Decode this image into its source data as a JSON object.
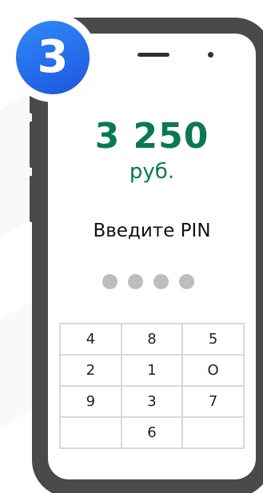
{
  "step_badge": {
    "number": "3"
  },
  "payment": {
    "amount": "3 250",
    "currency": "руб."
  },
  "pin": {
    "label": "Введите PIN",
    "dots_count": 4
  },
  "keypad": {
    "rows": [
      [
        "4",
        "8",
        "5"
      ],
      [
        "2",
        "1",
        "O"
      ],
      [
        "9",
        "3",
        "7"
      ],
      [
        "",
        "6",
        ""
      ]
    ]
  },
  "colors": {
    "accent_green": "#0a7a4e",
    "badge_blue": "#1f56de",
    "phone_frame": "#4a4a4a",
    "pin_dot": "#bdbdbd"
  }
}
